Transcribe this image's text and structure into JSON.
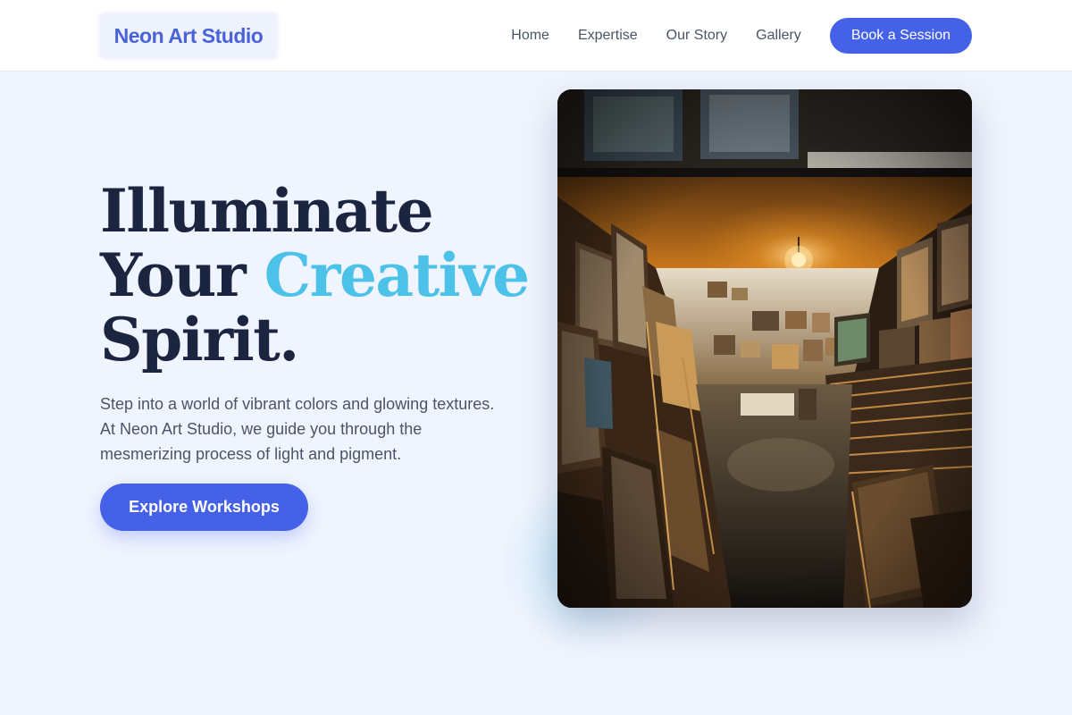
{
  "header": {
    "logo": "Neon Art Studio",
    "nav": [
      "Home",
      "Expertise",
      "Our Story",
      "Gallery"
    ],
    "cta": "Book a Session"
  },
  "hero": {
    "headline_line1": "Illuminate",
    "headline_line2_a": "Your ",
    "headline_line2_accent": "Creative",
    "headline_line3": "Spirit.",
    "lead": "Step into a world of vibrant colors and glowing textures. At Neon Art Studio, we guide you through the mesmerizing process of light and pigment.",
    "cta": "Explore Workshops",
    "image": "art-gallery-corridor-photo"
  },
  "colors": {
    "primary": "#4461e8",
    "accent": "#4cc2e8",
    "heading": "#1b2540",
    "background": "#f0f4fe"
  }
}
